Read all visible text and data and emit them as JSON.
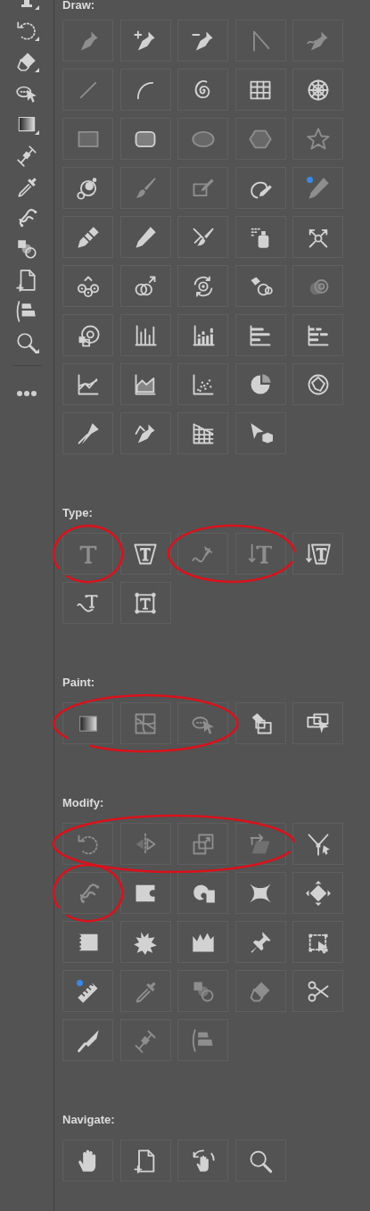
{
  "toolbar": {
    "tools": [
      {
        "flyout": true
      },
      {
        "flyout": true
      },
      {
        "flyout": true
      },
      {
        "flyout": false
      },
      {
        "flyout": true
      },
      {
        "flyout": false
      },
      {
        "flyout": false
      },
      {
        "flyout": false
      },
      {
        "flyout": false
      },
      {
        "flyout": false
      },
      {
        "flyout": false
      },
      {
        "flyout": true
      }
    ]
  },
  "sections": [
    {
      "title": "Draw:",
      "tools": [
        {
          "dimmed": true,
          "new": false,
          "marked": false
        },
        {
          "dimmed": false,
          "new": false,
          "marked": false
        },
        {
          "dimmed": false,
          "new": false,
          "marked": false
        },
        {
          "dimmed": true,
          "new": false,
          "marked": false
        },
        {
          "dimmed": true,
          "new": false,
          "marked": false
        },
        {
          "dimmed": true,
          "new": false,
          "marked": false
        },
        {
          "dimmed": false,
          "new": false,
          "marked": false
        },
        {
          "dimmed": false,
          "new": false,
          "marked": false
        },
        {
          "dimmed": false,
          "new": false,
          "marked": false
        },
        {
          "dimmed": false,
          "new": false,
          "marked": false
        },
        {
          "dimmed": true,
          "new": false,
          "marked": false
        },
        {
          "dimmed": false,
          "new": false,
          "marked": false
        },
        {
          "dimmed": true,
          "new": false,
          "marked": false
        },
        {
          "dimmed": true,
          "new": false,
          "marked": false
        },
        {
          "dimmed": true,
          "new": false,
          "marked": false
        },
        {
          "dimmed": false,
          "new": false,
          "marked": false
        },
        {
          "dimmed": true,
          "new": false,
          "marked": false
        },
        {
          "dimmed": true,
          "new": false,
          "marked": false
        },
        {
          "dimmed": false,
          "new": false,
          "marked": false
        },
        {
          "dimmed": true,
          "new": true,
          "marked": false
        },
        {
          "dimmed": false,
          "new": false,
          "marked": false
        },
        {
          "dimmed": false,
          "new": false,
          "marked": false
        },
        {
          "dimmed": false,
          "new": false,
          "marked": false
        },
        {
          "dimmed": false,
          "new": false,
          "marked": false
        },
        {
          "dimmed": false,
          "new": false,
          "marked": false
        },
        {
          "dimmed": false,
          "new": false,
          "marked": false
        },
        {
          "dimmed": false,
          "new": false,
          "marked": false
        },
        {
          "dimmed": false,
          "new": false,
          "marked": false
        },
        {
          "dimmed": false,
          "new": false,
          "marked": false
        },
        {
          "dimmed": true,
          "new": false,
          "marked": false
        },
        {
          "dimmed": false,
          "new": false,
          "marked": false
        },
        {
          "dimmed": false,
          "new": false,
          "marked": false
        },
        {
          "dimmed": false,
          "new": false,
          "marked": false
        },
        {
          "dimmed": false,
          "new": false,
          "marked": false
        },
        {
          "dimmed": false,
          "new": false,
          "marked": false
        },
        {
          "dimmed": false,
          "new": false,
          "marked": false
        },
        {
          "dimmed": false,
          "new": false,
          "marked": false
        },
        {
          "dimmed": false,
          "new": false,
          "marked": false
        },
        {
          "dimmed": false,
          "new": false,
          "marked": false
        },
        {
          "dimmed": false,
          "new": false,
          "marked": false
        },
        {
          "dimmed": false,
          "new": false,
          "marked": false
        },
        {
          "dimmed": false,
          "new": false,
          "marked": false
        },
        {
          "dimmed": false,
          "new": false,
          "marked": false
        },
        {
          "dimmed": false,
          "new": false,
          "marked": false
        }
      ]
    },
    {
      "title": "Type:",
      "tools": [
        {
          "dimmed": true,
          "new": false,
          "marked": true
        },
        {
          "dimmed": false,
          "new": false,
          "marked": false
        },
        {
          "dimmed": true,
          "new": false,
          "marked": true
        },
        {
          "dimmed": true,
          "new": false,
          "marked": true
        },
        {
          "dimmed": false,
          "new": false,
          "marked": false
        },
        {
          "dimmed": false,
          "new": false,
          "marked": false
        },
        {
          "dimmed": false,
          "new": false,
          "marked": false
        }
      ]
    },
    {
      "title": "Paint:",
      "tools": [
        {
          "dimmed": true,
          "new": false,
          "marked": true
        },
        {
          "dimmed": true,
          "new": false,
          "marked": true
        },
        {
          "dimmed": true,
          "new": false,
          "marked": true
        },
        {
          "dimmed": false,
          "new": false,
          "marked": false
        },
        {
          "dimmed": false,
          "new": false,
          "marked": false
        }
      ]
    },
    {
      "title": "Modify:",
      "tools": [
        {
          "dimmed": true,
          "new": false,
          "marked": true
        },
        {
          "dimmed": true,
          "new": false,
          "marked": true
        },
        {
          "dimmed": true,
          "new": false,
          "marked": true
        },
        {
          "dimmed": true,
          "new": false,
          "marked": true
        },
        {
          "dimmed": false,
          "new": false,
          "marked": false
        },
        {
          "dimmed": true,
          "new": false,
          "marked": true
        },
        {
          "dimmed": false,
          "new": false,
          "marked": false
        },
        {
          "dimmed": false,
          "new": false,
          "marked": false
        },
        {
          "dimmed": false,
          "new": false,
          "marked": false
        },
        {
          "dimmed": false,
          "new": false,
          "marked": false
        },
        {
          "dimmed": false,
          "new": false,
          "marked": false
        },
        {
          "dimmed": false,
          "new": false,
          "marked": false
        },
        {
          "dimmed": false,
          "new": false,
          "marked": false
        },
        {
          "dimmed": false,
          "new": false,
          "marked": false
        },
        {
          "dimmed": false,
          "new": false,
          "marked": false
        },
        {
          "dimmed": false,
          "new": true,
          "marked": false
        },
        {
          "dimmed": true,
          "new": false,
          "marked": false
        },
        {
          "dimmed": true,
          "new": false,
          "marked": false
        },
        {
          "dimmed": true,
          "new": false,
          "marked": false
        },
        {
          "dimmed": false,
          "new": false,
          "marked": false
        },
        {
          "dimmed": false,
          "new": false,
          "marked": false
        },
        {
          "dimmed": true,
          "new": false,
          "marked": false
        },
        {
          "dimmed": true,
          "new": false,
          "marked": false
        }
      ]
    },
    {
      "title": "Navigate:",
      "tools": [
        {
          "dimmed": false,
          "new": false,
          "marked": false
        },
        {
          "dimmed": false,
          "new": false,
          "marked": false
        },
        {
          "dimmed": false,
          "new": false,
          "marked": false
        },
        {
          "dimmed": false,
          "new": false,
          "marked": false
        }
      ]
    }
  ]
}
